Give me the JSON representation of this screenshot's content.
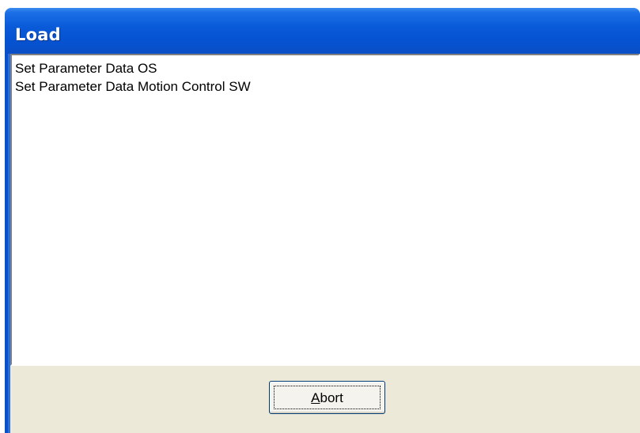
{
  "window": {
    "title": "Load"
  },
  "log": {
    "lines": [
      "Set Parameter Data OS",
      "Set Parameter Data Motion Control SW"
    ]
  },
  "actions": {
    "abort_label": "Abort",
    "abort_mnemonic": "A",
    "abort_rest": "bort"
  },
  "colors": {
    "titlebar": "#0553d2",
    "client_bg": "#ece9d8",
    "list_bg": "#ffffff"
  }
}
